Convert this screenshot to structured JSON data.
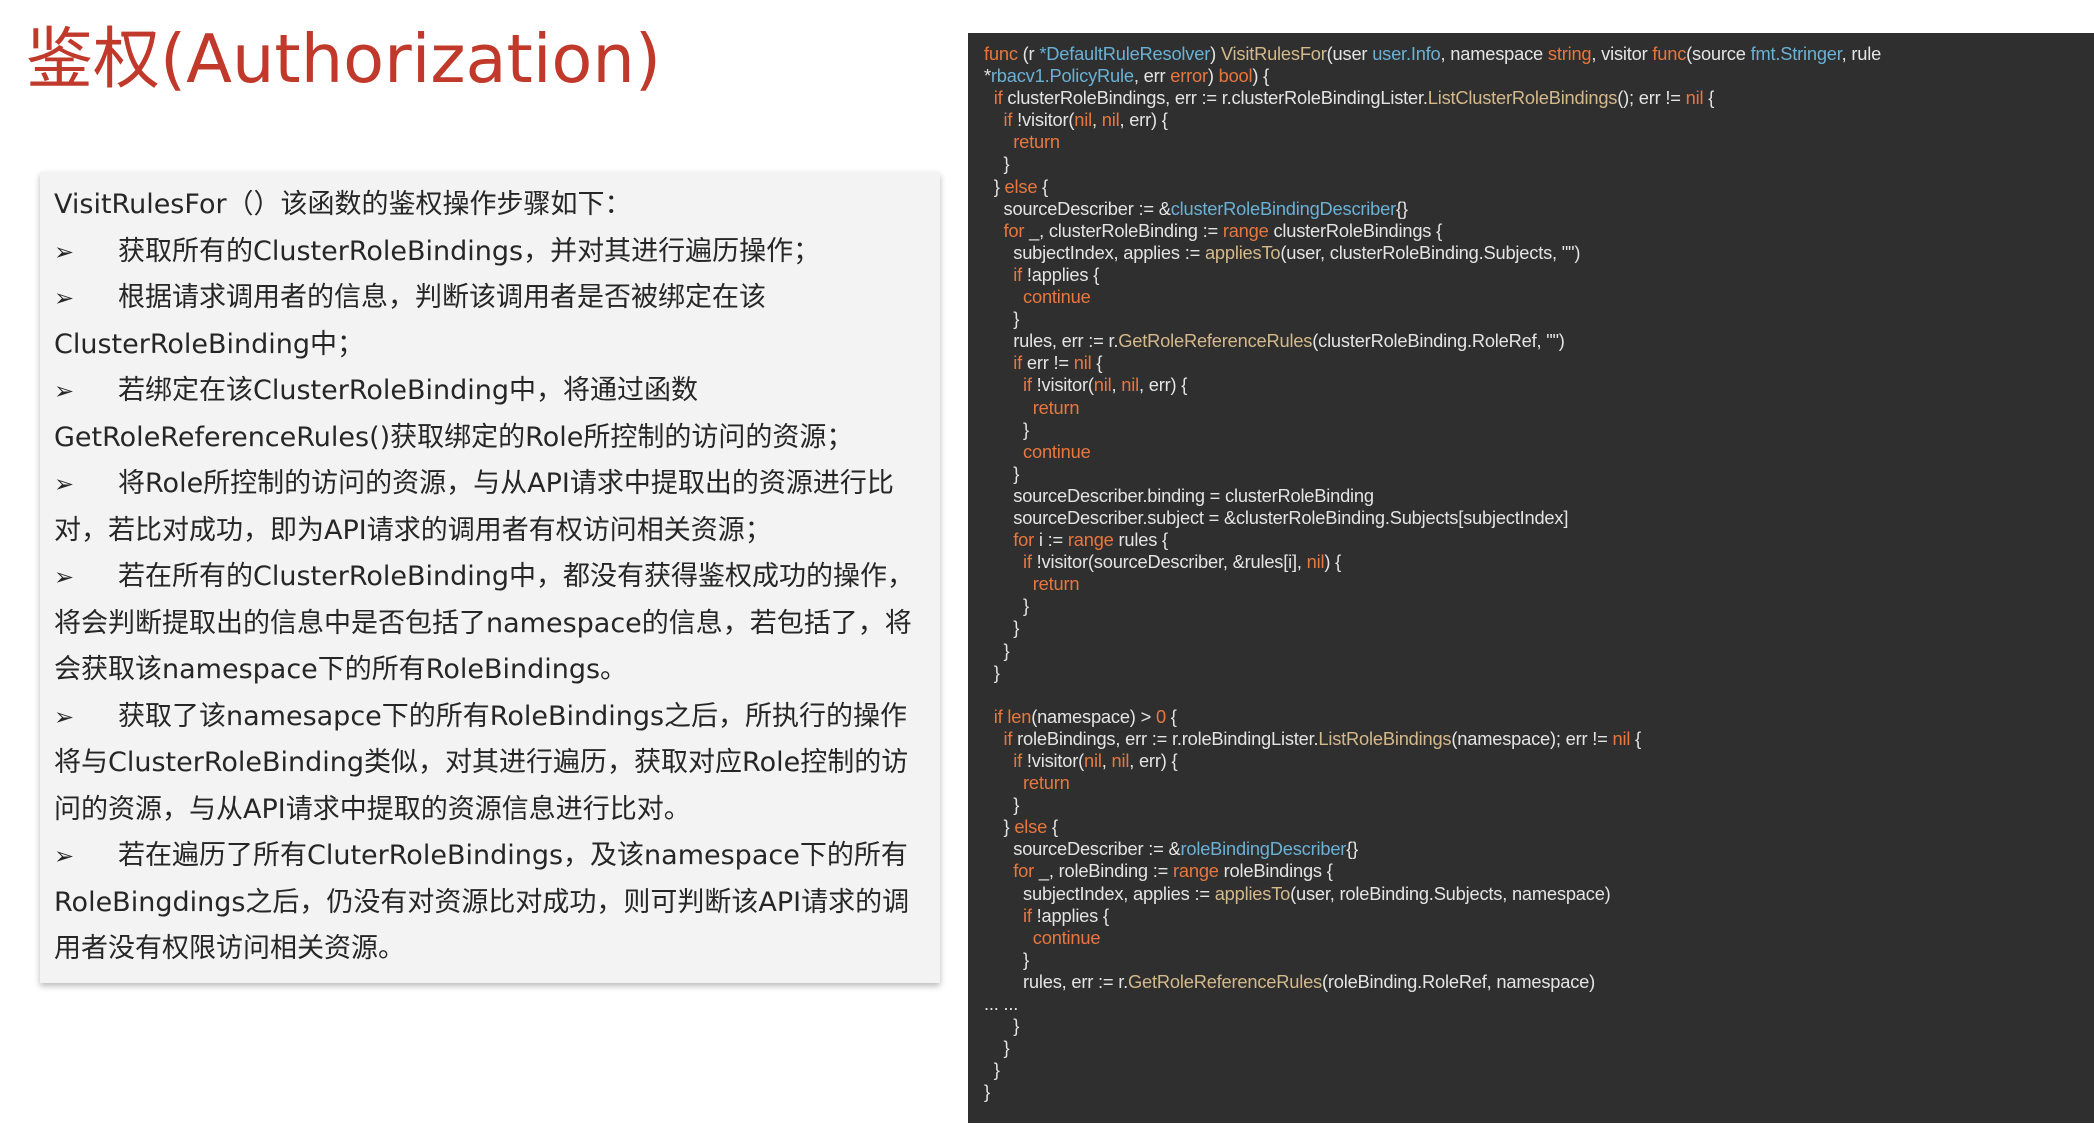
{
  "title": "鉴权(Authorization)",
  "colors": {
    "title": "#c0392b",
    "code_background": "#2f2f2f",
    "code_text": "#e4e4e4",
    "code_keyword": "#e8773f",
    "code_function": "#d4b98a",
    "code_type": "#6ab1d6",
    "textbox_background": "#f3f3f3"
  },
  "description": {
    "intro": "VisitRulesFor（）该函数的鉴权操作步骤如下：",
    "bullet_icon": "arrow-bullet-icon",
    "bullet_glyph": "➢",
    "bullets": [
      [
        "获取所有的ClusterRoleBindings，并对其进行遍历操作；"
      ],
      [
        "根据请求调用者的信息，判断该调用者是否被绑定在该",
        "ClusterRoleBinding中；"
      ],
      [
        "若绑定在该ClusterRoleBinding中，将通过函数",
        "GetRoleReferenceRules()获取绑定的Role所控制的访问的资源；"
      ],
      [
        "将Role所控制的访问的资源，与从API请求中提取出的资源进行比",
        "对，若比对成功，即为API请求的调用者有权访问相关资源；"
      ],
      [
        "若在所有的ClusterRoleBinding中，都没有获得鉴权成功的操作，",
        "将会判断提取出的信息中是否包括了namespace的信息，若包括了，将",
        "会获取该namespace下的所有RoleBindings。"
      ],
      [
        "获取了该namesapce下的所有RoleBindings之后，所执行的操作",
        "将与ClusterRoleBinding类似，对其进行遍历，获取对应Role控制的访",
        "问的资源，与从API请求中提取的资源信息进行比对。"
      ],
      [
        "若在遍历了所有CluterRoleBindings，及该namespace下的所有",
        "RoleBingdings之后，仍没有对资源比对成功，则可判断该API请求的调",
        "用者没有权限访问相关资源。"
      ]
    ]
  },
  "code": {
    "language": "go",
    "lines": [
      [
        [
          "kw",
          "func"
        ],
        [
          "pl",
          " (r "
        ],
        [
          "tp",
          "*DefaultRuleResolver"
        ],
        [
          "pl",
          ") "
        ],
        [
          "fn",
          "VisitRulesFor"
        ],
        [
          "pl",
          "(user "
        ],
        [
          "tp",
          "user.Info"
        ],
        [
          "pl",
          ", namespace "
        ],
        [
          "kw",
          "string"
        ],
        [
          "pl",
          ", visitor "
        ],
        [
          "kw",
          "func"
        ],
        [
          "pl",
          "(source "
        ],
        [
          "tp",
          "fmt.Stringer"
        ],
        [
          "pl",
          ", rule"
        ]
      ],
      [
        [
          "pl",
          "*"
        ],
        [
          "tp",
          "rbacv1.PolicyRule"
        ],
        [
          "pl",
          ", err "
        ],
        [
          "kw",
          "error"
        ],
        [
          "pl",
          ") "
        ],
        [
          "kw",
          "bool"
        ],
        [
          "pl",
          ") {"
        ]
      ],
      [
        [
          "pl",
          "  "
        ],
        [
          "kw",
          "if"
        ],
        [
          "pl",
          " clusterRoleBindings, err := r.clusterRoleBindingLister."
        ],
        [
          "fn",
          "ListClusterRoleBindings"
        ],
        [
          "pl",
          "(); err != "
        ],
        [
          "kw",
          "nil"
        ],
        [
          "pl",
          " {"
        ]
      ],
      [
        [
          "pl",
          "    "
        ],
        [
          "kw",
          "if"
        ],
        [
          "pl",
          " !visitor("
        ],
        [
          "kw",
          "nil"
        ],
        [
          "pl",
          ", "
        ],
        [
          "kw",
          "nil"
        ],
        [
          "pl",
          ", err) {"
        ]
      ],
      [
        [
          "pl",
          "      "
        ],
        [
          "kw",
          "return"
        ]
      ],
      [
        [
          "pl",
          "    }"
        ]
      ],
      [
        [
          "pl",
          "  } "
        ],
        [
          "kw",
          "else"
        ],
        [
          "pl",
          " {"
        ]
      ],
      [
        [
          "pl",
          "    sourceDescriber := &"
        ],
        [
          "tp",
          "clusterRoleBindingDescriber"
        ],
        [
          "pl",
          "{}"
        ]
      ],
      [
        [
          "pl",
          "    "
        ],
        [
          "kw",
          "for"
        ],
        [
          "pl",
          " _, clusterRoleBinding := "
        ],
        [
          "kw",
          "range"
        ],
        [
          "pl",
          " clusterRoleBindings {"
        ]
      ],
      [
        [
          "pl",
          "      subjectIndex, applies := "
        ],
        [
          "fn",
          "appliesTo"
        ],
        [
          "pl",
          "(user, clusterRoleBinding.Subjects, \"\")"
        ]
      ],
      [
        [
          "pl",
          "      "
        ],
        [
          "kw",
          "if"
        ],
        [
          "pl",
          " !applies {"
        ]
      ],
      [
        [
          "pl",
          "        "
        ],
        [
          "kw",
          "continue"
        ]
      ],
      [
        [
          "pl",
          "      }"
        ]
      ],
      [
        [
          "pl",
          "      rules, err := r."
        ],
        [
          "fn",
          "GetRoleReferenceRules"
        ],
        [
          "pl",
          "(clusterRoleBinding.RoleRef, \"\")"
        ]
      ],
      [
        [
          "pl",
          "      "
        ],
        [
          "kw",
          "if"
        ],
        [
          "pl",
          " err != "
        ],
        [
          "kw",
          "nil"
        ],
        [
          "pl",
          " {"
        ]
      ],
      [
        [
          "pl",
          "        "
        ],
        [
          "kw",
          "if"
        ],
        [
          "pl",
          " !visitor("
        ],
        [
          "kw",
          "nil"
        ],
        [
          "pl",
          ", "
        ],
        [
          "kw",
          "nil"
        ],
        [
          "pl",
          ", err) {"
        ]
      ],
      [
        [
          "pl",
          "          "
        ],
        [
          "kw",
          "return"
        ]
      ],
      [
        [
          "pl",
          "        }"
        ]
      ],
      [
        [
          "pl",
          "        "
        ],
        [
          "kw",
          "continue"
        ]
      ],
      [
        [
          "pl",
          "      }"
        ]
      ],
      [
        [
          "pl",
          "      sourceDescriber.binding = clusterRoleBinding"
        ]
      ],
      [
        [
          "pl",
          "      sourceDescriber.subject = &clusterRoleBinding.Subjects[subjectIndex]"
        ]
      ],
      [
        [
          "pl",
          "      "
        ],
        [
          "kw",
          "for"
        ],
        [
          "pl",
          " i := "
        ],
        [
          "kw",
          "range"
        ],
        [
          "pl",
          " rules {"
        ]
      ],
      [
        [
          "pl",
          "        "
        ],
        [
          "kw",
          "if"
        ],
        [
          "pl",
          " !visitor(sourceDescriber, &rules[i], "
        ],
        [
          "kw",
          "nil"
        ],
        [
          "pl",
          ") {"
        ]
      ],
      [
        [
          "pl",
          "          "
        ],
        [
          "kw",
          "return"
        ]
      ],
      [
        [
          "pl",
          "        }"
        ]
      ],
      [
        [
          "pl",
          "      }"
        ]
      ],
      [
        [
          "pl",
          "    }"
        ]
      ],
      [
        [
          "pl",
          "  }"
        ]
      ],
      [
        [
          "pl",
          ""
        ]
      ],
      [
        [
          "pl",
          "  "
        ],
        [
          "kw",
          "if"
        ],
        [
          "pl",
          " "
        ],
        [
          "kw",
          "len"
        ],
        [
          "pl",
          "(namespace) > "
        ],
        [
          "kw",
          "0"
        ],
        [
          "pl",
          " {"
        ]
      ],
      [
        [
          "pl",
          "    "
        ],
        [
          "kw",
          "if"
        ],
        [
          "pl",
          " roleBindings, err := r.roleBindingLister."
        ],
        [
          "fn",
          "ListRoleBindings"
        ],
        [
          "pl",
          "(namespace); err != "
        ],
        [
          "kw",
          "nil"
        ],
        [
          "pl",
          " {"
        ]
      ],
      [
        [
          "pl",
          "      "
        ],
        [
          "kw",
          "if"
        ],
        [
          "pl",
          " !visitor("
        ],
        [
          "kw",
          "nil"
        ],
        [
          "pl",
          ", "
        ],
        [
          "kw",
          "nil"
        ],
        [
          "pl",
          ", err) {"
        ]
      ],
      [
        [
          "pl",
          "        "
        ],
        [
          "kw",
          "return"
        ]
      ],
      [
        [
          "pl",
          "      }"
        ]
      ],
      [
        [
          "pl",
          "    } "
        ],
        [
          "kw",
          "else"
        ],
        [
          "pl",
          " {"
        ]
      ],
      [
        [
          "pl",
          "      sourceDescriber := &"
        ],
        [
          "tp",
          "roleBindingDescriber"
        ],
        [
          "pl",
          "{}"
        ]
      ],
      [
        [
          "pl",
          "      "
        ],
        [
          "kw",
          "for"
        ],
        [
          "pl",
          " _, roleBinding := "
        ],
        [
          "kw",
          "range"
        ],
        [
          "pl",
          " roleBindings {"
        ]
      ],
      [
        [
          "pl",
          "        subjectIndex, applies := "
        ],
        [
          "fn",
          "appliesTo"
        ],
        [
          "pl",
          "(user, roleBinding.Subjects, namespace)"
        ]
      ],
      [
        [
          "pl",
          "        "
        ],
        [
          "kw",
          "if"
        ],
        [
          "pl",
          " !applies {"
        ]
      ],
      [
        [
          "pl",
          "          "
        ],
        [
          "kw",
          "continue"
        ]
      ],
      [
        [
          "pl",
          "        }"
        ]
      ],
      [
        [
          "pl",
          "        rules, err := r."
        ],
        [
          "fn",
          "GetRoleReferenceRules"
        ],
        [
          "pl",
          "(roleBinding.RoleRef, namespace)"
        ]
      ],
      [
        [
          "pl",
          "... ..."
        ]
      ],
      [
        [
          "pl",
          "      }"
        ]
      ],
      [
        [
          "pl",
          "    }"
        ]
      ],
      [
        [
          "pl",
          "  }"
        ]
      ],
      [
        [
          "pl",
          "}"
        ]
      ]
    ]
  }
}
